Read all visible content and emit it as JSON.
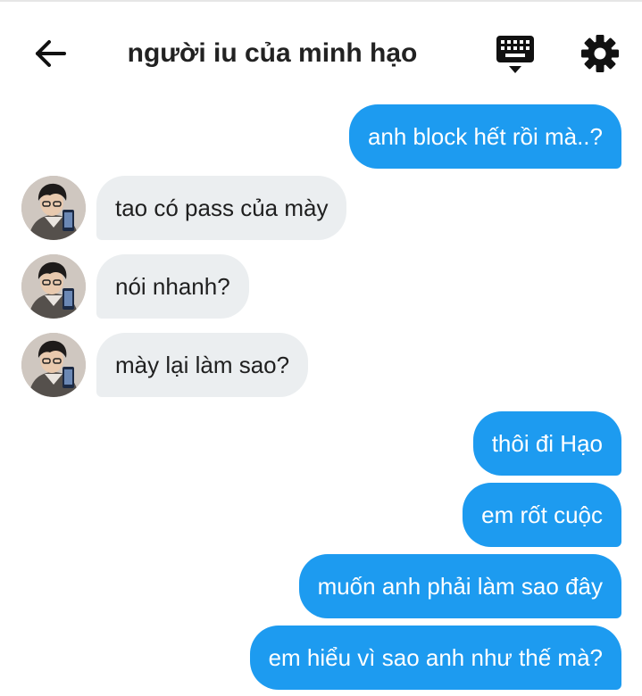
{
  "header": {
    "title": "người iu của minh hạo",
    "back_icon": "arrow-left-icon",
    "keyboard_icon": "keyboard-icon",
    "settings_icon": "gear-icon"
  },
  "messages": [
    {
      "side": "out",
      "text": "anh block hết rồi mà..?"
    },
    {
      "side": "in",
      "text": "tao có pass của mày"
    },
    {
      "side": "in",
      "text": "nói nhanh?"
    },
    {
      "side": "in",
      "text": "mày lại làm sao?"
    },
    {
      "side": "out",
      "text": "thôi đi Hạo"
    },
    {
      "side": "out",
      "text": "em rốt cuộc"
    },
    {
      "side": "out",
      "text": "muốn anh phải làm sao đây"
    },
    {
      "side": "out",
      "text": "em hiểu vì sao anh như thế mà?"
    }
  ],
  "colors": {
    "outgoing_bubble": "#1d9bf0",
    "incoming_bubble": "#ebeef0",
    "text_dark": "#1f1f1f"
  }
}
